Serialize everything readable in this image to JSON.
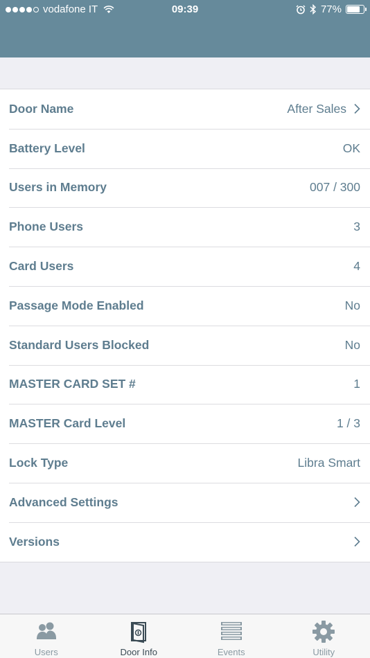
{
  "status_bar": {
    "carrier": "vodafone IT",
    "time": "09:39",
    "battery_percent": "77%",
    "battery_level": 0.77,
    "signal_bars_filled": 4,
    "signal_bars_total": 5
  },
  "colors": {
    "header_bg": "#668a9b",
    "text_accent": "#5e7d8f",
    "tab_active": "#3b4b55",
    "tab_inactive": "#8a9aa3"
  },
  "door_info": {
    "rows": [
      {
        "label": "Door Name",
        "value": "After Sales",
        "chevron": true
      },
      {
        "label": "Battery Level",
        "value": "OK",
        "chevron": false
      },
      {
        "label": "Users in Memory",
        "value": "007 / 300",
        "chevron": false
      },
      {
        "label": "Phone Users",
        "value": "3",
        "chevron": false
      },
      {
        "label": "Card Users",
        "value": "4",
        "chevron": false
      },
      {
        "label": "Passage Mode Enabled",
        "value": "No",
        "chevron": false
      },
      {
        "label": "Standard Users Blocked",
        "value": "No",
        "chevron": false
      },
      {
        "label": "MASTER CARD SET #",
        "value": "1",
        "chevron": false
      },
      {
        "label": "MASTER Card Level",
        "value": "1 / 3",
        "chevron": false
      },
      {
        "label": "Lock Type",
        "value": "Libra Smart",
        "chevron": false
      },
      {
        "label": "Advanced Settings",
        "value": "",
        "chevron": true
      },
      {
        "label": "Versions",
        "value": "",
        "chevron": true
      }
    ]
  },
  "tab_bar": {
    "tabs": [
      {
        "label": "Users",
        "icon": "users-icon",
        "active": false
      },
      {
        "label": "Door Info",
        "icon": "door-icon",
        "active": true
      },
      {
        "label": "Events",
        "icon": "events-list-icon",
        "active": false
      },
      {
        "label": "Utility",
        "icon": "gear-icon",
        "active": false
      }
    ]
  }
}
